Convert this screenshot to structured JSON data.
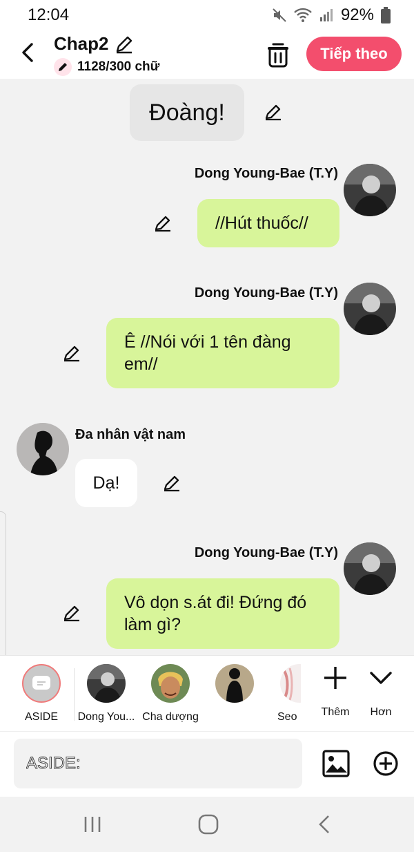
{
  "status": {
    "time": "12:04",
    "battery": "92%"
  },
  "header": {
    "title": "Chap2",
    "word_count": "1128/300 chữ",
    "next_label": "Tiếp theo",
    "accent": "#f34e6d"
  },
  "messages": [
    {
      "type": "aside",
      "text": "Đoàng!"
    },
    {
      "type": "right",
      "name": "Dong Young-Bae (T.Y)",
      "text": "//Hút thuốc//"
    },
    {
      "type": "right",
      "name": "Dong Young-Bae (T.Y)",
      "text": "Ê //Nói với 1 tên đàng em//"
    },
    {
      "type": "left",
      "name": "Đa nhân vật nam",
      "text": "Dạ!"
    },
    {
      "type": "right",
      "name": "Dong Young-Bae (T.Y)",
      "text": "Vô dọn s.át đi! Đứng đó làm gì?"
    }
  ],
  "characters": [
    {
      "label": "ASIDE"
    },
    {
      "label": "Dong You..."
    },
    {
      "label": "Cha dượng"
    },
    {
      "label": ""
    },
    {
      "label": "Seo"
    }
  ],
  "tools": {
    "add_label": "Thêm",
    "more_label": "Hơn"
  },
  "input": {
    "placeholder": "ASIDE:"
  },
  "colors": {
    "bubble_green": "#d8f59a",
    "background": "#f2f2f2"
  }
}
